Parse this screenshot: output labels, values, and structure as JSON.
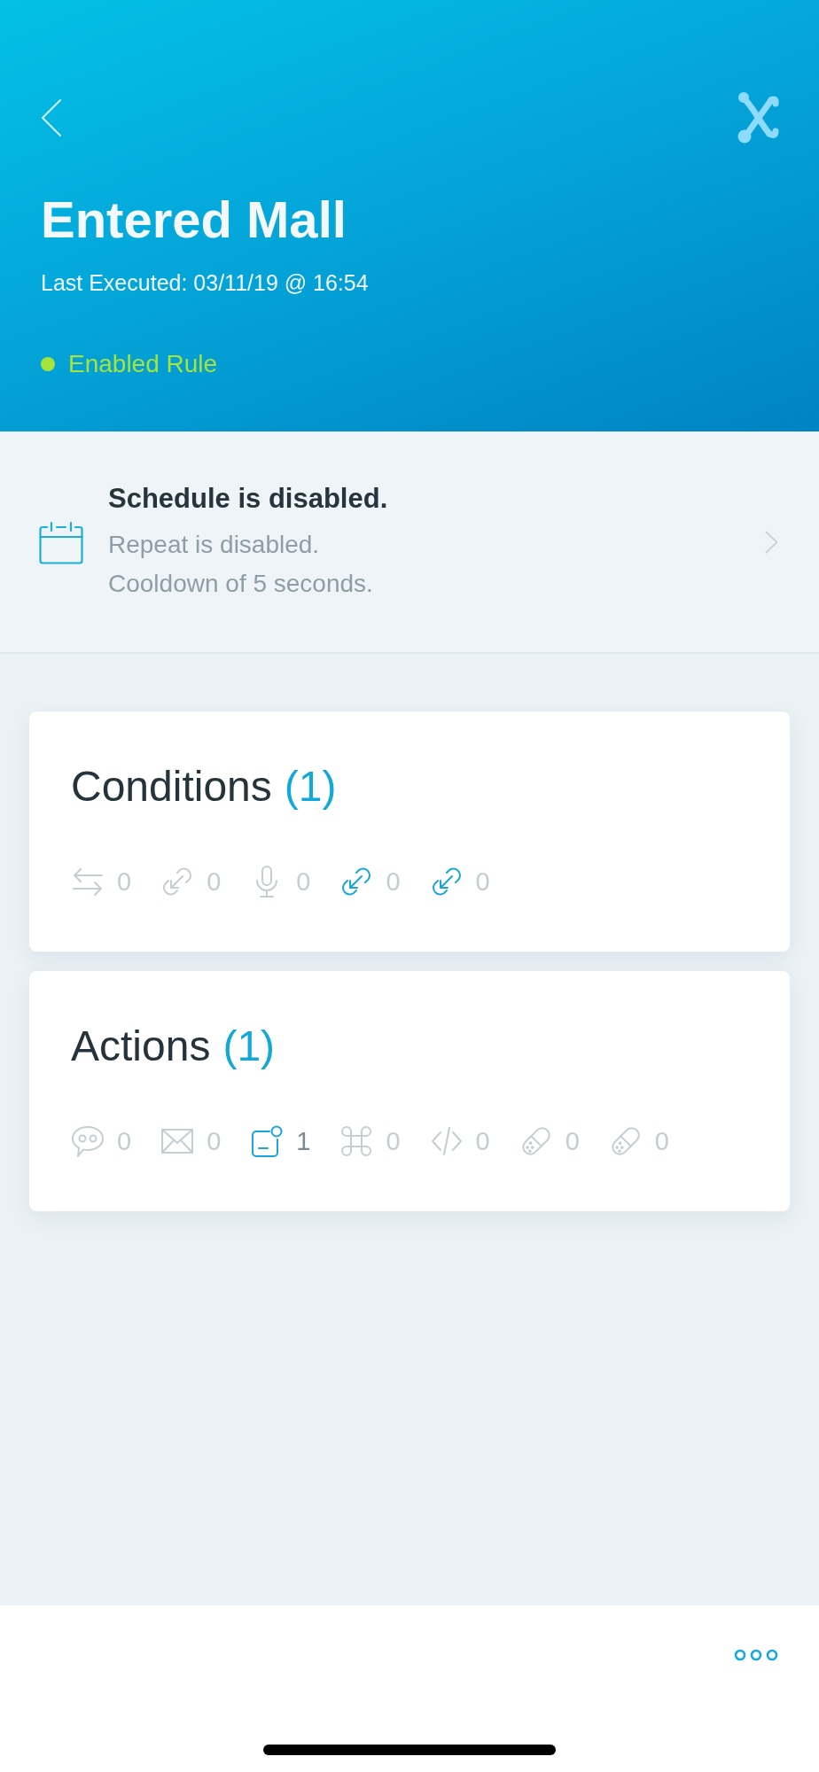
{
  "header": {
    "title": "Entered Mall",
    "last_executed": "Last Executed: 03/11/19 @ 16:54",
    "status": {
      "label": "Enabled Rule",
      "enabled": true
    }
  },
  "schedule": {
    "title": "Schedule is disabled.",
    "details": [
      "Repeat is disabled.",
      "Cooldown of 5 seconds."
    ]
  },
  "cards": [
    {
      "title": "Conditions",
      "count": "(1)",
      "items": [
        {
          "kind": "swap",
          "count": "0",
          "highlighted": false,
          "emphasized": false
        },
        {
          "kind": "link",
          "count": "0",
          "highlighted": false,
          "emphasized": false
        },
        {
          "kind": "mic",
          "count": "0",
          "highlighted": false,
          "emphasized": false
        },
        {
          "kind": "link",
          "count": "0",
          "highlighted": true,
          "emphasized": false
        },
        {
          "kind": "link",
          "count": "0",
          "highlighted": true,
          "emphasized": false
        }
      ]
    },
    {
      "title": "Actions",
      "count": "(1)",
      "items": [
        {
          "kind": "chat",
          "count": "0",
          "highlighted": false,
          "emphasized": false
        },
        {
          "kind": "mail",
          "count": "0",
          "highlighted": false,
          "emphasized": false
        },
        {
          "kind": "notification",
          "count": "1",
          "highlighted": true,
          "emphasized": true
        },
        {
          "kind": "command",
          "count": "0",
          "highlighted": false,
          "emphasized": false
        },
        {
          "kind": "code",
          "count": "0",
          "highlighted": false,
          "emphasized": false
        },
        {
          "kind": "pill",
          "count": "0",
          "highlighted": false,
          "emphasized": false
        },
        {
          "kind": "pill",
          "count": "0",
          "highlighted": false,
          "emphasized": false
        }
      ]
    }
  ]
}
